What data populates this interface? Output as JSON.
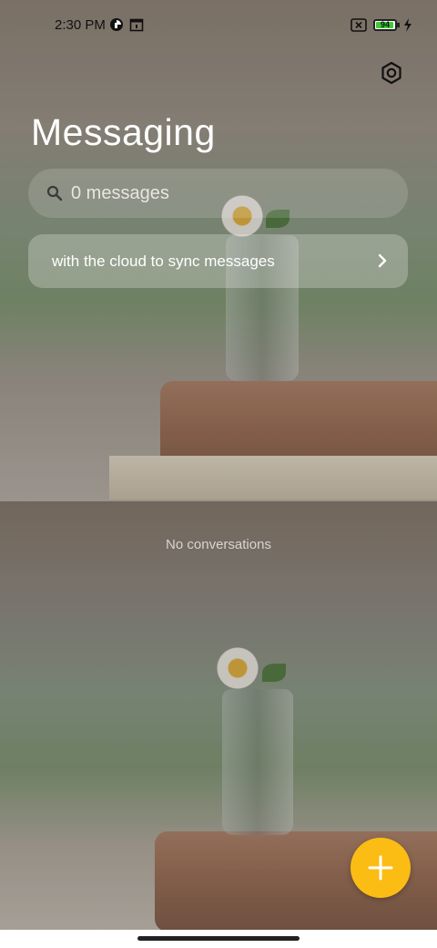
{
  "status_bar": {
    "time": "2:30 PM",
    "battery_level": "94",
    "icons": [
      "data-saver-icon",
      "calendar-icon",
      "sim-none-icon",
      "battery-icon",
      "charging-icon"
    ]
  },
  "header": {
    "title": "Messaging",
    "settings_icon": "settings-icon"
  },
  "search": {
    "placeholder": "0 messages",
    "icon": "search-icon"
  },
  "sync_banner": {
    "text": "with the cloud to sync messages",
    "icon": "chevron-right-icon"
  },
  "main": {
    "empty_text": "No conversations"
  },
  "fab": {
    "icon": "plus-icon",
    "color": "#fbbd14"
  }
}
